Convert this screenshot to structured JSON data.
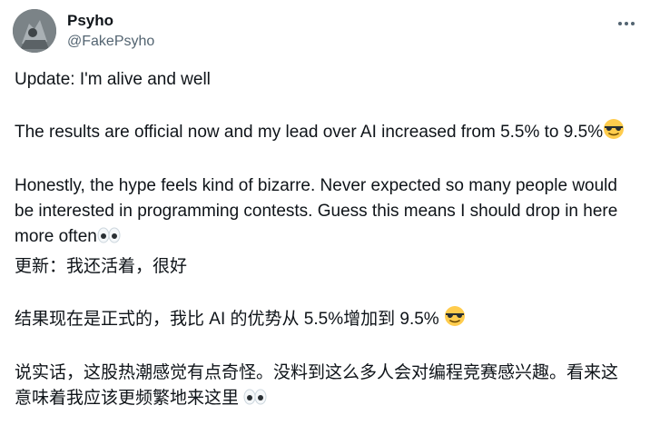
{
  "author": {
    "name": "Psyho",
    "handle": "@FakePsyho"
  },
  "icons": {
    "more": "more-horizontal-icon",
    "sunglasses": "smiling-face-with-sunglasses-emoji",
    "eyes": "eyes-emoji"
  },
  "tweet": {
    "p1": "Update: I'm alive and well",
    "p2": "The results are official now and my lead over AI increased from 5.5% to 9.5%",
    "p3": "Honestly, the hype feels kind of bizarre. Never expected so many people would be interested in programming contests. Guess this means I should drop in here more often",
    "p4": "更新：我还活着，很好",
    "p5": "结果现在是正式的，我比 AI 的优势从 5.5%增加到 9.5% ",
    "p6": "说实话，这股热潮感觉有点奇怪。没料到这么多人会对编程竞赛感兴趣。看来这意味着我应该更频繁地来这里 "
  }
}
